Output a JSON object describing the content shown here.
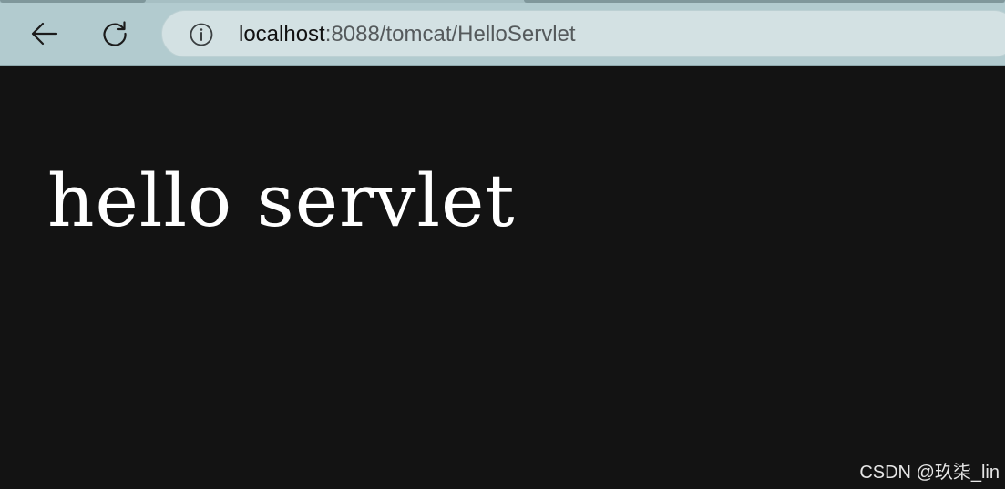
{
  "toolbar": {
    "back_icon": "arrow-left-icon",
    "reload_icon": "reload-icon",
    "info_icon": "info-icon"
  },
  "address_bar": {
    "host": "localhost",
    "path": ":8088/tomcat/HelloServlet"
  },
  "page": {
    "body_text": "hello servlet"
  },
  "watermark": {
    "text": "CSDN @玖柒_lin"
  },
  "colors": {
    "toolbar_bg": "#b2cbcf",
    "address_bar_bg": "#d3e1e3",
    "page_bg": "#131313",
    "page_text": "#ffffff"
  }
}
